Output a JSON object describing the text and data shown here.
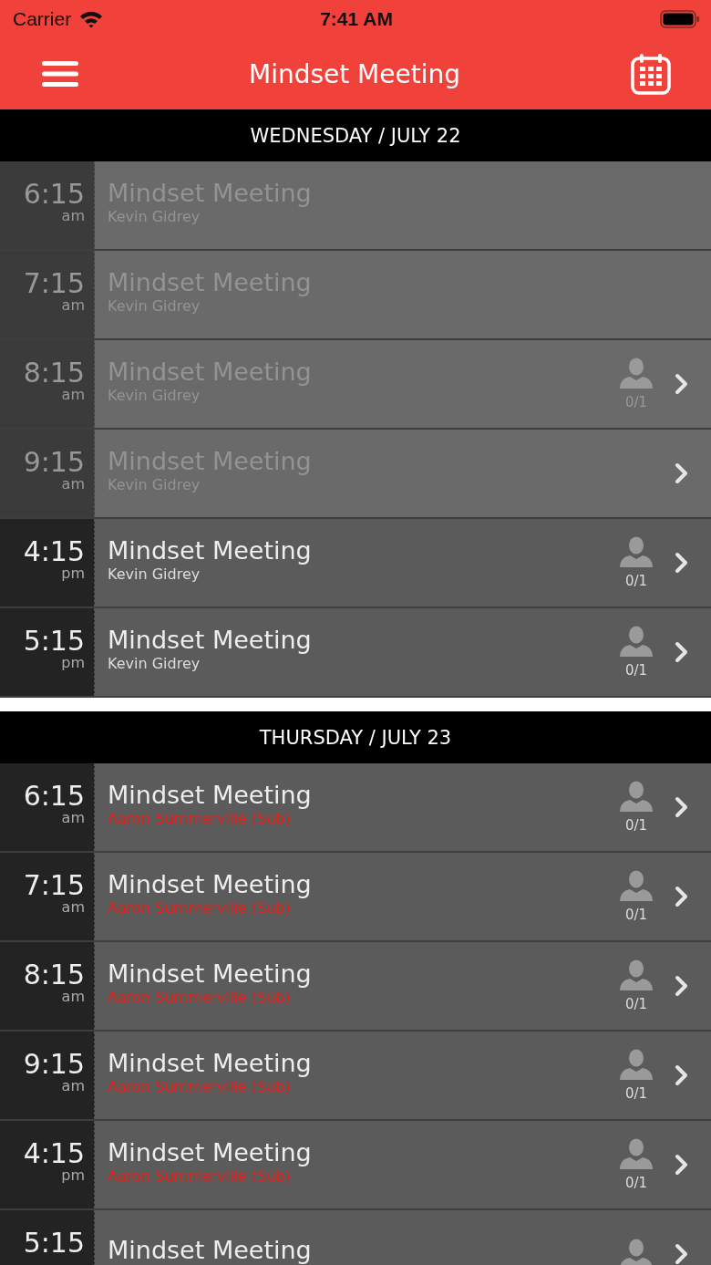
{
  "status_bar": {
    "carrier": "Carrier",
    "time": "7:41 AM"
  },
  "nav": {
    "title": "Mindset Meeting"
  },
  "days": [
    {
      "heading": "WEDNESDAY / JULY 22",
      "sessions": [
        {
          "time": "6:15",
          "meridiem": "am",
          "title": "Mindset Meeting",
          "instructor": "Kevin Gidrey",
          "substitute": false,
          "past": true,
          "person_icon": false,
          "chevron": false
        },
        {
          "time": "7:15",
          "meridiem": "am",
          "title": "Mindset Meeting",
          "instructor": "Kevin Gidrey",
          "substitute": false,
          "past": true,
          "person_icon": false,
          "chevron": false
        },
        {
          "time": "8:15",
          "meridiem": "am",
          "title": "Mindset Meeting",
          "instructor": "Kevin Gidrey",
          "substitute": false,
          "past": true,
          "person_icon": true,
          "spots": "0/1",
          "chevron": true
        },
        {
          "time": "9:15",
          "meridiem": "am",
          "title": "Mindset Meeting",
          "instructor": "Kevin Gidrey",
          "substitute": false,
          "past": true,
          "person_icon": false,
          "chevron": true
        },
        {
          "time": "4:15",
          "meridiem": "pm",
          "title": "Mindset Meeting",
          "instructor": "Kevin Gidrey",
          "substitute": false,
          "past": false,
          "person_icon": true,
          "spots": "0/1",
          "chevron": true
        },
        {
          "time": "5:15",
          "meridiem": "pm",
          "title": "Mindset Meeting",
          "instructor": "Kevin Gidrey",
          "substitute": false,
          "past": false,
          "person_icon": true,
          "spots": "0/1",
          "chevron": true
        }
      ]
    },
    {
      "heading": "THURSDAY / JULY 23",
      "sessions": [
        {
          "time": "6:15",
          "meridiem": "am",
          "title": "Mindset Meeting",
          "instructor": "Aaron Summerville (Sub)",
          "substitute": true,
          "past": false,
          "person_icon": true,
          "spots": "0/1",
          "chevron": true
        },
        {
          "time": "7:15",
          "meridiem": "am",
          "title": "Mindset Meeting",
          "instructor": "Aaron Summerville (Sub)",
          "substitute": true,
          "past": false,
          "person_icon": true,
          "spots": "0/1",
          "chevron": true
        },
        {
          "time": "8:15",
          "meridiem": "am",
          "title": "Mindset Meeting",
          "instructor": "Aaron Summerville (Sub)",
          "substitute": true,
          "past": false,
          "person_icon": true,
          "spots": "0/1",
          "chevron": true
        },
        {
          "time": "9:15",
          "meridiem": "am",
          "title": "Mindset Meeting",
          "instructor": "Aaron Summerville (Sub)",
          "substitute": true,
          "past": false,
          "person_icon": true,
          "spots": "0/1",
          "chevron": true
        },
        {
          "time": "4:15",
          "meridiem": "pm",
          "title": "Mindset Meeting",
          "instructor": "Aaron Summerville (Sub)",
          "substitute": true,
          "past": false,
          "person_icon": true,
          "spots": "0/1",
          "chevron": true
        },
        {
          "time": "5:15",
          "title": "Mindset Meeting",
          "past": false,
          "person_icon": true,
          "chevron": true
        }
      ]
    }
  ]
}
